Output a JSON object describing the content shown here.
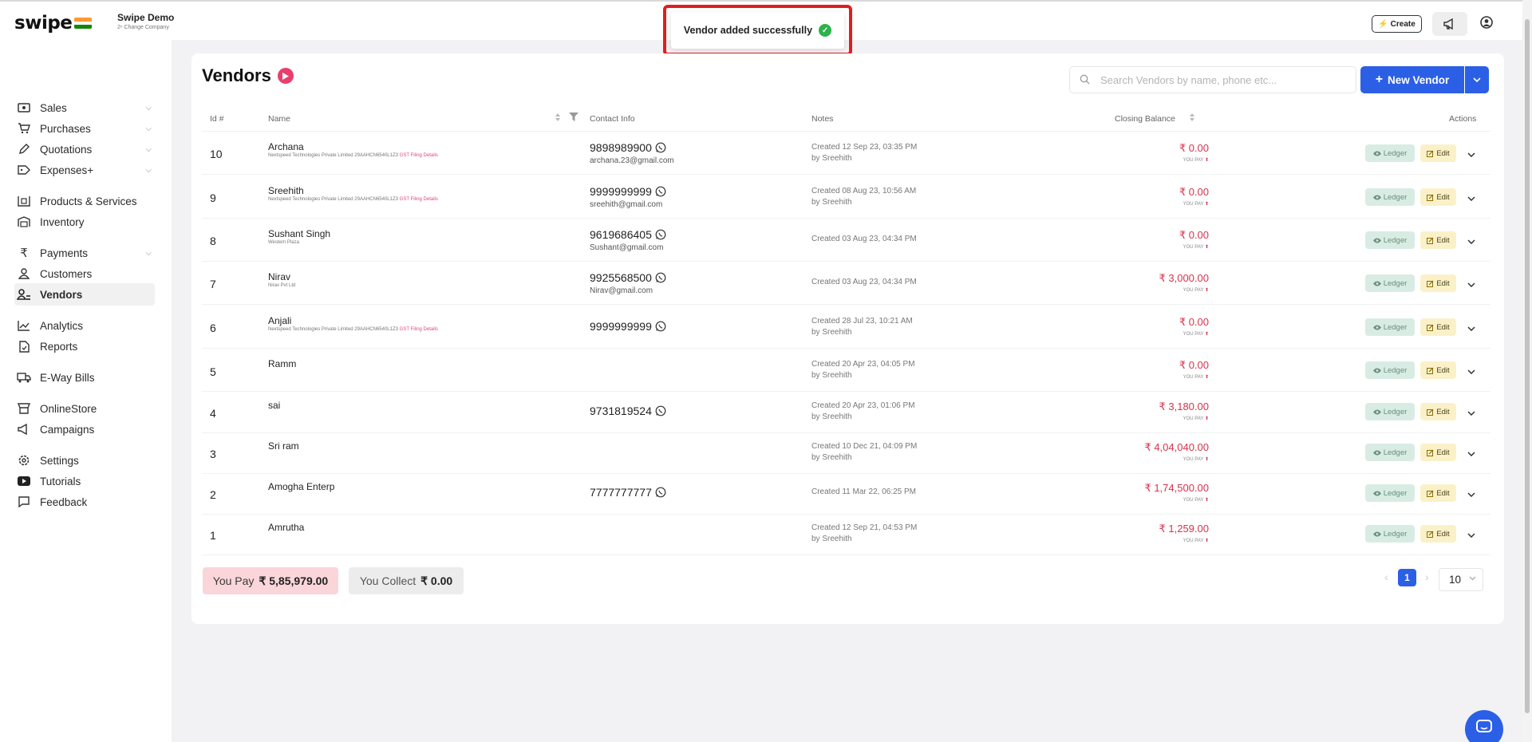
{
  "brand": {
    "logo_text": "swipe",
    "company_name": "Swipe Demo",
    "company_sub": "2ⁿ Change Company"
  },
  "header": {
    "create_label": "Create"
  },
  "toast": {
    "message": "Vendor added successfully"
  },
  "sidebar": {
    "items": [
      {
        "label": "Sales",
        "icon": "cash-icon",
        "chevron": true
      },
      {
        "label": "Purchases",
        "icon": "cart-icon",
        "chevron": true
      },
      {
        "label": "Quotations",
        "icon": "pen-icon",
        "chevron": true
      },
      {
        "label": "Expenses+",
        "icon": "tag-icon",
        "chevron": true
      },
      {
        "label": "Products & Services",
        "icon": "box-icon",
        "chevron": false
      },
      {
        "label": "Inventory",
        "icon": "warehouse-icon",
        "chevron": false
      },
      {
        "label": "Payments",
        "icon": "rupee-icon",
        "chevron": true
      },
      {
        "label": "Customers",
        "icon": "user-icon",
        "chevron": false
      },
      {
        "label": "Vendors",
        "icon": "users-icon",
        "chevron": false,
        "active": true
      },
      {
        "label": "Analytics",
        "icon": "chart-icon",
        "chevron": false
      },
      {
        "label": "Reports",
        "icon": "report-icon",
        "chevron": false
      },
      {
        "label": "E-Way Bills",
        "icon": "truck-icon",
        "chevron": false
      },
      {
        "label": "OnlineStore",
        "icon": "store-icon",
        "chevron": false
      },
      {
        "label": "Campaigns",
        "icon": "megaphone-icon",
        "chevron": false
      },
      {
        "label": "Settings",
        "icon": "settings-icon",
        "chevron": false
      },
      {
        "label": "Tutorials",
        "icon": "youtube-icon",
        "chevron": false
      },
      {
        "label": "Feedback",
        "icon": "chat-icon",
        "chevron": false
      }
    ]
  },
  "page": {
    "title": "Vendors",
    "search_placeholder": "Search Vendors by name, phone etc...",
    "new_vendor_label": "New Vendor"
  },
  "table": {
    "headers": {
      "id": "Id #",
      "name": "Name",
      "contact": "Contact Info",
      "notes": "Notes",
      "balance": "Closing Balance",
      "actions": "Actions"
    },
    "ledger_label": "Ledger",
    "edit_label": "Edit",
    "rows": [
      {
        "id": "10",
        "name": "Archana",
        "sub": "Nextspeed Technologies Private Limited 29AAHCN6540L1Z3",
        "sub_link": "GST Filing Details",
        "phone": "9898989900",
        "email": "archana.23@gmail.com",
        "note1": "Created 12 Sep 23, 03:35 PM",
        "note2": "by Sreehith",
        "balance": "₹ 0.00",
        "pay": "YOU PAY"
      },
      {
        "id": "9",
        "name": "Sreehith",
        "sub": "Nextspeed Technologies Private Limited 29AAHCN6540L1Z3",
        "sub_link": "GST Filing Details",
        "phone": "9999999999",
        "email": "sreehith@gmail.com",
        "note1": "Created 08 Aug 23, 10:56 AM",
        "note2": "by Sreehith",
        "balance": "₹ 0.00",
        "pay": "YOU PAY"
      },
      {
        "id": "8",
        "name": "Sushant Singh",
        "sub": "Western Plaza",
        "sub_link": "",
        "phone": "9619686405",
        "email": "Sushant@gmail.com",
        "note1": "Created 03 Aug 23, 04:34 PM",
        "note2": "",
        "balance": "₹ 0.00",
        "pay": "YOU PAY"
      },
      {
        "id": "7",
        "name": "Nirav",
        "sub": "Nirav Pvt Ltd",
        "sub_link": "",
        "phone": "9925568500",
        "email": "Nirav@gmail.com",
        "note1": "Created 03 Aug 23, 04:34 PM",
        "note2": "",
        "balance": "₹ 3,000.00",
        "pay": "YOU PAY"
      },
      {
        "id": "6",
        "name": "Anjali",
        "sub": "Nextspeed Technologies Private Limited 29AAHCN6540L1Z3",
        "sub_link": "GST Filing Details",
        "phone": "9999999999",
        "email": "",
        "note1": "Created 28 Jul 23, 10:21 AM",
        "note2": "by Sreehith",
        "balance": "₹ 0.00",
        "pay": "YOU PAY"
      },
      {
        "id": "5",
        "name": "Ramm",
        "sub": "",
        "sub_link": "",
        "phone": "",
        "email": "",
        "note1": "Created 20 Apr 23, 04:05 PM",
        "note2": "by Sreehith",
        "balance": "₹ 0.00",
        "pay": "YOU PAY"
      },
      {
        "id": "4",
        "name": "sai",
        "sub": "",
        "sub_link": "",
        "phone": "9731819524",
        "email": "",
        "note1": "Created 20 Apr 23, 01:06 PM",
        "note2": "by Sreehith",
        "balance": "₹ 3,180.00",
        "pay": "YOU PAY"
      },
      {
        "id": "3",
        "name": "Sri ram",
        "sub": "",
        "sub_link": "",
        "phone": "",
        "email": "",
        "note1": "Created 10 Dec 21, 04:09 PM",
        "note2": "by Sreehith",
        "balance": "₹ 4,04,040.00",
        "pay": "YOU PAY"
      },
      {
        "id": "2",
        "name": "Amogha Enterp",
        "sub": "",
        "sub_link": "",
        "phone": "7777777777",
        "email": "",
        "note1": "Created 11 Mar 22, 06:25 PM",
        "note2": "",
        "balance": "₹ 1,74,500.00",
        "pay": "YOU PAY"
      },
      {
        "id": "1",
        "name": "Amrutha",
        "sub": "",
        "sub_link": "",
        "phone": "",
        "email": "",
        "note1": "Created 12 Sep 21, 04:53 PM",
        "note2": "by Sreehith",
        "balance": "₹ 1,259.00",
        "pay": "YOU PAY"
      }
    ]
  },
  "summary": {
    "pay_label": "You Pay",
    "pay_value": "₹ 5,85,979.00",
    "collect_label": "You Collect",
    "collect_value": "₹ 0.00"
  },
  "pager": {
    "current": "1",
    "page_size": "10"
  },
  "colors": {
    "accent": "#2b5fe6",
    "negative": "#d6334e",
    "ledger_bg": "#d8ece4",
    "edit_bg": "#fbf1c9"
  }
}
